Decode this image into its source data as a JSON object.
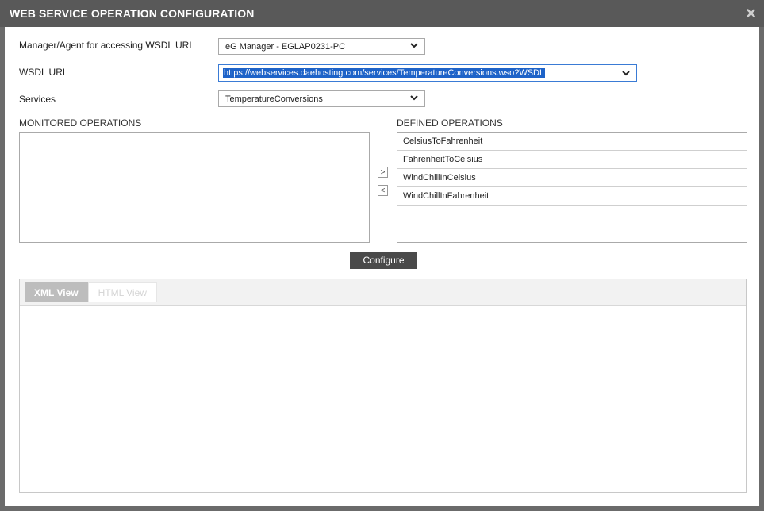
{
  "dialog": {
    "title": "WEB SERVICE OPERATION CONFIGURATION",
    "close_icon": "×"
  },
  "form": {
    "manager_label": "Manager/Agent for accessing WSDL URL",
    "manager_value": "eG Manager - EGLAP0231-PC",
    "wsdl_label": "WSDL URL",
    "wsdl_value": "https://webservices.daehosting.com/services/TemperatureConversions.wso?WSDL",
    "services_label": "Services",
    "services_value": "TemperatureConversions"
  },
  "monitored": {
    "label": "MONITORED OPERATIONS"
  },
  "defined": {
    "label": "DEFINED OPERATIONS",
    "items": [
      "CelsiusToFahrenheit",
      "FahrenheitToCelsius",
      "WindChillInCelsius",
      "WindChillInFahrenheit"
    ]
  },
  "arrows": {
    "right": ">",
    "left": "<"
  },
  "configure_label": "Configure",
  "view_tabs": {
    "xml": "XML View",
    "html": "HTML View"
  }
}
